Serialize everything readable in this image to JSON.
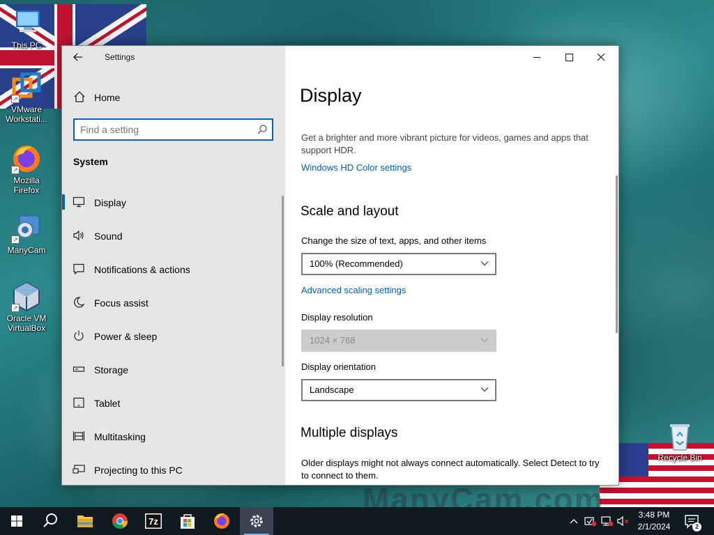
{
  "desktop": {
    "icons": [
      {
        "label": "This PC",
        "icon": "this-pc-icon"
      },
      {
        "label": "VMware Workstati...",
        "icon": "vmware-icon"
      },
      {
        "label": "Mozilla Firefox",
        "icon": "firefox-icon"
      },
      {
        "label": "ManyCam",
        "icon": "manycam-icon"
      },
      {
        "label": "Oracle VM VirtualBox",
        "icon": "virtualbox-icon"
      },
      {
        "label": "Recycle Bin",
        "icon": "recycle-bin-icon"
      }
    ],
    "wallpaper_text": "ManyCam.com"
  },
  "window": {
    "title": "Settings",
    "back_icon": "back-arrow-icon",
    "controls": {
      "minimize_icon": "minimize-icon",
      "maximize_icon": "maximize-icon",
      "close_icon": "close-icon"
    }
  },
  "sidebar": {
    "home_label": "Home",
    "search": {
      "placeholder": "Find a setting",
      "value": ""
    },
    "section": "System",
    "items": [
      {
        "label": "Display",
        "icon": "monitor-icon",
        "selected": true
      },
      {
        "label": "Sound",
        "icon": "speaker-icon",
        "selected": false
      },
      {
        "label": "Notifications & actions",
        "icon": "notification-icon",
        "selected": false
      },
      {
        "label": "Focus assist",
        "icon": "moon-icon",
        "selected": false
      },
      {
        "label": "Power & sleep",
        "icon": "power-icon",
        "selected": false
      },
      {
        "label": "Storage",
        "icon": "storage-icon",
        "selected": false
      },
      {
        "label": "Tablet",
        "icon": "tablet-icon",
        "selected": false
      },
      {
        "label": "Multitasking",
        "icon": "multitasking-icon",
        "selected": false
      },
      {
        "label": "Projecting to this PC",
        "icon": "projecting-icon",
        "selected": false
      }
    ]
  },
  "main": {
    "title": "Display",
    "hdr_text": "Get a brighter and more vibrant picture for videos, games and apps that support HDR.",
    "hdr_link": "Windows HD Color settings",
    "scale_heading": "Scale and layout",
    "scale_label": "Change the size of text, apps, and other items",
    "scale_value": "100% (Recommended)",
    "advanced_link": "Advanced scaling settings",
    "resolution_label": "Display resolution",
    "resolution_value": "1024 × 768",
    "orientation_label": "Display orientation",
    "orientation_value": "Landscape",
    "multiple_heading": "Multiple displays",
    "multiple_text": "Older displays might not always connect automatically. Select Detect to try to connect to them."
  },
  "taskbar": {
    "apps": [
      {
        "name": "start",
        "icon": "windows-start-icon"
      },
      {
        "name": "search",
        "icon": "search-icon"
      },
      {
        "name": "file-explorer",
        "icon": "folder-icon"
      },
      {
        "name": "chrome",
        "icon": "chrome-icon"
      },
      {
        "name": "7zip",
        "icon": "7zip-icon",
        "label": "7z"
      },
      {
        "name": "store",
        "icon": "store-icon"
      },
      {
        "name": "firefox",
        "icon": "firefox-icon"
      },
      {
        "name": "settings",
        "icon": "gear-icon"
      }
    ],
    "tray": {
      "chevron_icon": "chevron-up-icon",
      "time": "3:48 PM",
      "date": "2/1/2024",
      "notification_count": "2"
    }
  }
}
